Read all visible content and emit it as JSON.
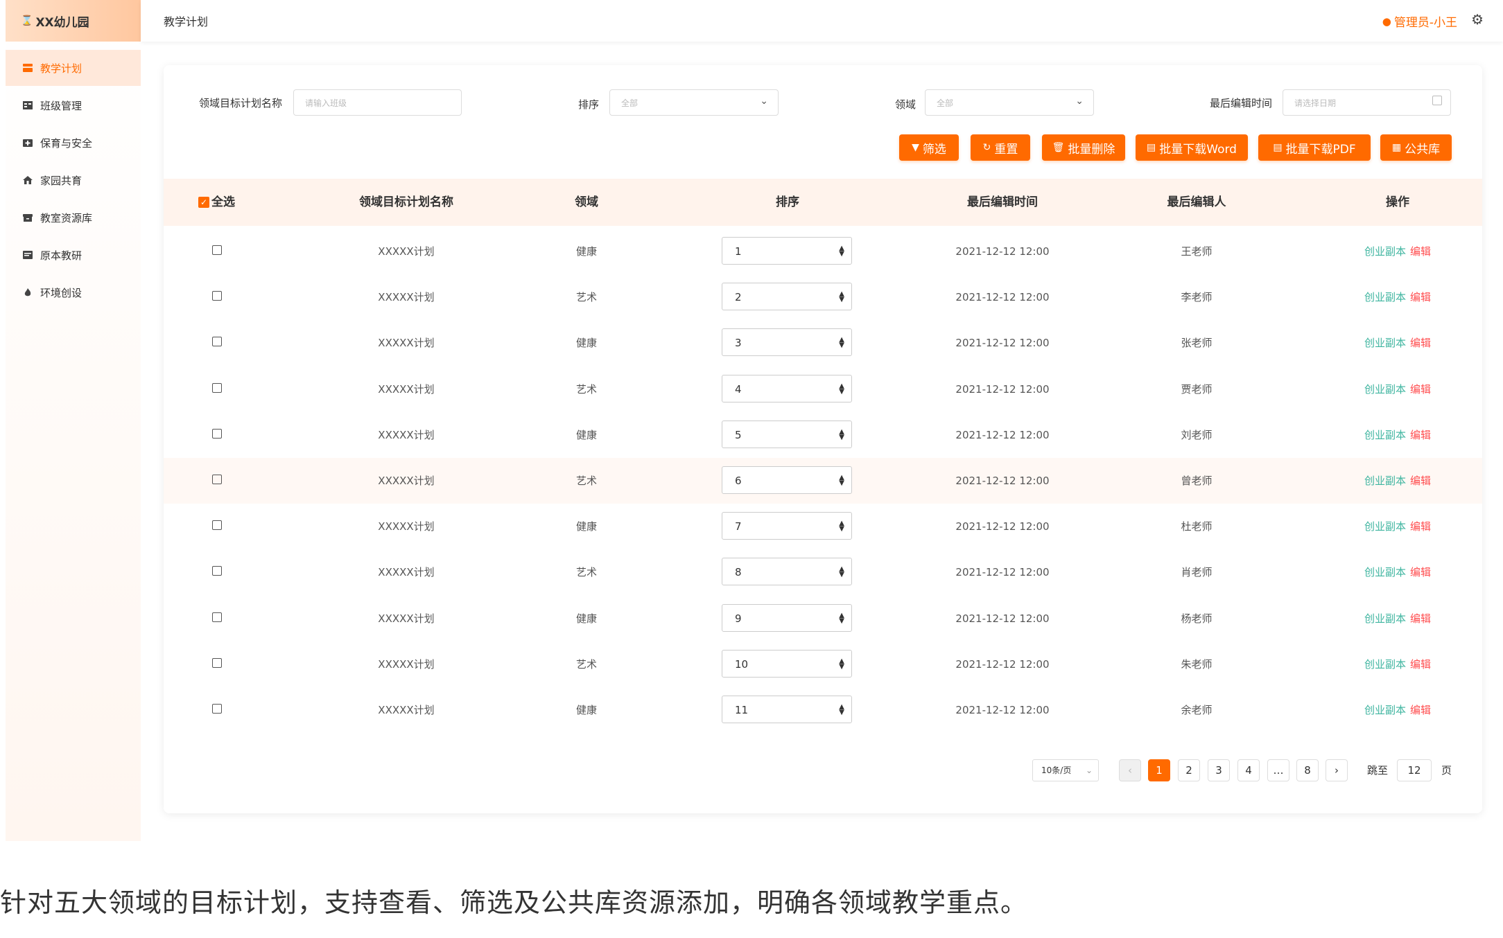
{
  "app": {
    "name": "XX幼儿园"
  },
  "sidebar": {
    "items": [
      {
        "label": "教学计划",
        "icon": "doc-stack-icon"
      },
      {
        "label": "班级管理",
        "icon": "class-grid-icon"
      },
      {
        "label": "保育与安全",
        "icon": "first-aid-icon"
      },
      {
        "label": "家园共育",
        "icon": "home-icon"
      },
      {
        "label": "教室资源库",
        "icon": "archive-icon"
      },
      {
        "label": "原本教研",
        "icon": "board-icon"
      },
      {
        "label": "环境创设",
        "icon": "flame-icon"
      }
    ]
  },
  "header": {
    "title": "教学计划",
    "user": "管理员-小王"
  },
  "filters": {
    "name_label": "领域目标计划名称",
    "name_placeholder": "请输入班级",
    "sort_label": "排序",
    "sort_value": "全部",
    "domain_label": "领域",
    "domain_value": "全部",
    "time_label": "最后编辑时间",
    "time_placeholder": "请选择日期"
  },
  "toolbar": {
    "filter": "筛选",
    "reset": "重置",
    "batch_delete": "批量删除",
    "download_word": "批量下载Word",
    "download_pdf": "批量下载PDF",
    "public_lib": "公共库"
  },
  "table": {
    "headers": {
      "select_all": "全选",
      "name": "领域目标计划名称",
      "domain": "领域",
      "sort": "排序",
      "time": "最后编辑时间",
      "editor": "最后编辑人",
      "actions": "操作"
    },
    "action_copy": "创业副本",
    "action_edit": "编辑",
    "rows": [
      {
        "name": "XXXXX计划",
        "domain": "健康",
        "sort": "1",
        "time": "2021-12-12 12:00",
        "editor": "王老师"
      },
      {
        "name": "XXXXX计划",
        "domain": "艺术",
        "sort": "2",
        "time": "2021-12-12 12:00",
        "editor": "李老师"
      },
      {
        "name": "XXXXX计划",
        "domain": "健康",
        "sort": "3",
        "time": "2021-12-12 12:00",
        "editor": "张老师"
      },
      {
        "name": "XXXXX计划",
        "domain": "艺术",
        "sort": "4",
        "time": "2021-12-12 12:00",
        "editor": "贾老师"
      },
      {
        "name": "XXXXX计划",
        "domain": "健康",
        "sort": "5",
        "time": "2021-12-12 12:00",
        "editor": "刘老师"
      },
      {
        "name": "XXXXX计划",
        "domain": "艺术",
        "sort": "6",
        "time": "2021-12-12 12:00",
        "editor": "曾老师"
      },
      {
        "name": "XXXXX计划",
        "domain": "健康",
        "sort": "7",
        "time": "2021-12-12 12:00",
        "editor": "杜老师"
      },
      {
        "name": "XXXXX计划",
        "domain": "艺术",
        "sort": "8",
        "time": "2021-12-12 12:00",
        "editor": "肖老师"
      },
      {
        "name": "XXXXX计划",
        "domain": "健康",
        "sort": "9",
        "time": "2021-12-12 12:00",
        "editor": "杨老师"
      },
      {
        "name": "XXXXX计划",
        "domain": "艺术",
        "sort": "10",
        "time": "2021-12-12 12:00",
        "editor": "朱老师"
      },
      {
        "name": "XXXXX计划",
        "domain": "健康",
        "sort": "11",
        "time": "2021-12-12 12:00",
        "editor": "余老师"
      }
    ]
  },
  "pagination": {
    "page_size": "10条/页",
    "pages": [
      "1",
      "2",
      "3",
      "4",
      "…",
      "8"
    ],
    "current": "1",
    "goto_label": "跳至",
    "goto_value": "12",
    "page_unit": "页"
  },
  "caption": "针对五大领域的目标计划，支持查看、筛选及公共库资源添加，明确各领域教学重点。",
  "colors": {
    "accent": "#ff6a00",
    "copy_link": "#3fb5a0",
    "edit_link": "#ff4d4f",
    "header_bg": "#fff3ec"
  }
}
